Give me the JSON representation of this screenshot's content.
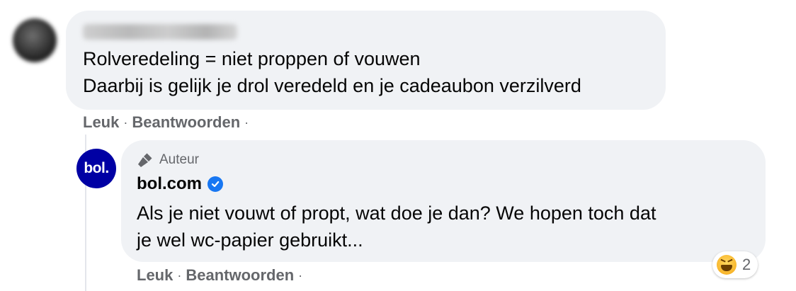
{
  "comment1": {
    "author_name_blurred": "Corry Dankemans",
    "lines": [
      "Rolveredeling = niet proppen of vouwen",
      "Daarbij is gelijk je drol veredeld en je cadeaubon verzilverd"
    ],
    "actions": {
      "like": "Leuk",
      "reply": "Beantwoorden"
    }
  },
  "comment2": {
    "author_badge": "Auteur",
    "avatar_text": "bol.",
    "author_name": "bol.com",
    "verified_icon": "verified-check-icon",
    "lines": [
      "Als je niet vouwt of propt, wat doe je dan? We hopen toch dat",
      "je wel wc-papier gebruikt..."
    ],
    "actions": {
      "like": "Leuk",
      "reply": "Beantwoorden"
    },
    "reaction": {
      "emoji": "laughing-emoji-icon",
      "count": "2"
    }
  },
  "colors": {
    "bubble": "#f0f2f5",
    "secondary_text": "#65676b",
    "bol_blue": "#0000a4",
    "verified_blue": "#1877f2"
  }
}
